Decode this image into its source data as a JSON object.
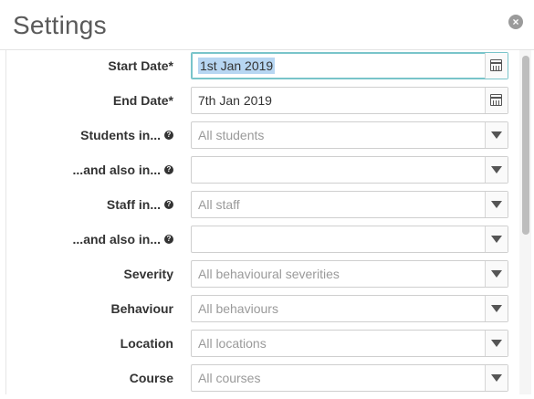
{
  "dialog": {
    "title": "Settings",
    "close_icon": "close-icon"
  },
  "form": {
    "fields": [
      {
        "label": "Start Date*",
        "type": "date",
        "value": "1st Jan 2019",
        "placeholder": "",
        "icon": "calendar-icon",
        "selected": true
      },
      {
        "label": "End Date*",
        "type": "date",
        "value": "7th Jan 2019",
        "placeholder": "",
        "icon": "calendar-icon",
        "selected": false
      },
      {
        "label": "Students in...",
        "type": "select",
        "value": "",
        "placeholder": "All students",
        "icon": "chevron-down-icon",
        "help": true
      },
      {
        "label": "...and also in...",
        "type": "select",
        "value": "",
        "placeholder": "",
        "icon": "chevron-down-icon",
        "help": true
      },
      {
        "label": "Staff in...",
        "type": "select",
        "value": "",
        "placeholder": "All staff",
        "icon": "chevron-down-icon",
        "help": true
      },
      {
        "label": "...and also in...",
        "type": "select",
        "value": "",
        "placeholder": "",
        "icon": "chevron-down-icon",
        "help": true
      },
      {
        "label": "Severity",
        "type": "select",
        "value": "",
        "placeholder": "All behavioural severities",
        "icon": "chevron-down-icon"
      },
      {
        "label": "Behaviour",
        "type": "select",
        "value": "",
        "placeholder": "All behaviours",
        "icon": "chevron-down-icon"
      },
      {
        "label": "Location",
        "type": "select",
        "value": "",
        "placeholder": "All locations",
        "icon": "chevron-down-icon"
      },
      {
        "label": "Course",
        "type": "select",
        "value": "",
        "placeholder": "All courses",
        "icon": "chevron-down-icon"
      }
    ]
  },
  "colors": {
    "active_border": "#79c4ca",
    "selection": "#b7d6f2"
  }
}
